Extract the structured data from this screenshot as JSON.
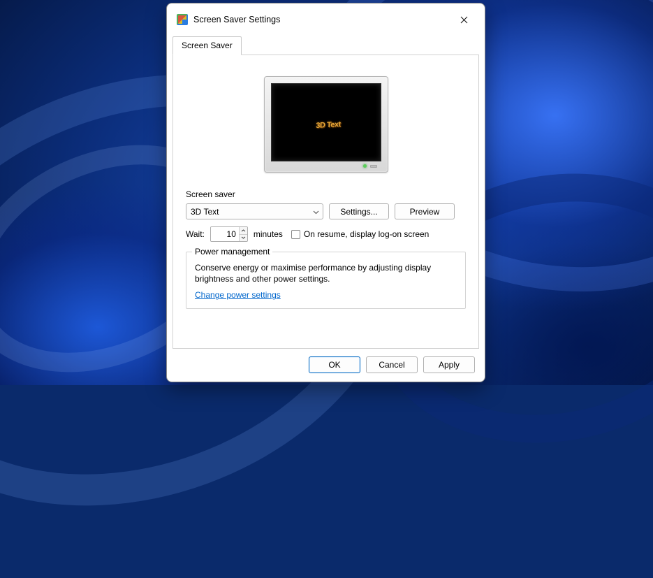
{
  "window": {
    "title": "Screen Saver Settings"
  },
  "tabs": {
    "screensaver": "Screen Saver"
  },
  "preview": {
    "sample_text": "3D Text"
  },
  "screensaver_group": {
    "label": "Screen saver",
    "selected": "3D Text",
    "settings_btn": "Settings...",
    "preview_btn": "Preview"
  },
  "wait": {
    "label": "Wait:",
    "value": "10",
    "unit": "minutes",
    "resume_label": "On resume, display log-on screen"
  },
  "power": {
    "legend": "Power management",
    "desc": "Conserve energy or maximise performance by adjusting display brightness and other power settings.",
    "link": "Change power settings"
  },
  "buttons": {
    "ok": "OK",
    "cancel": "Cancel",
    "apply": "Apply"
  }
}
